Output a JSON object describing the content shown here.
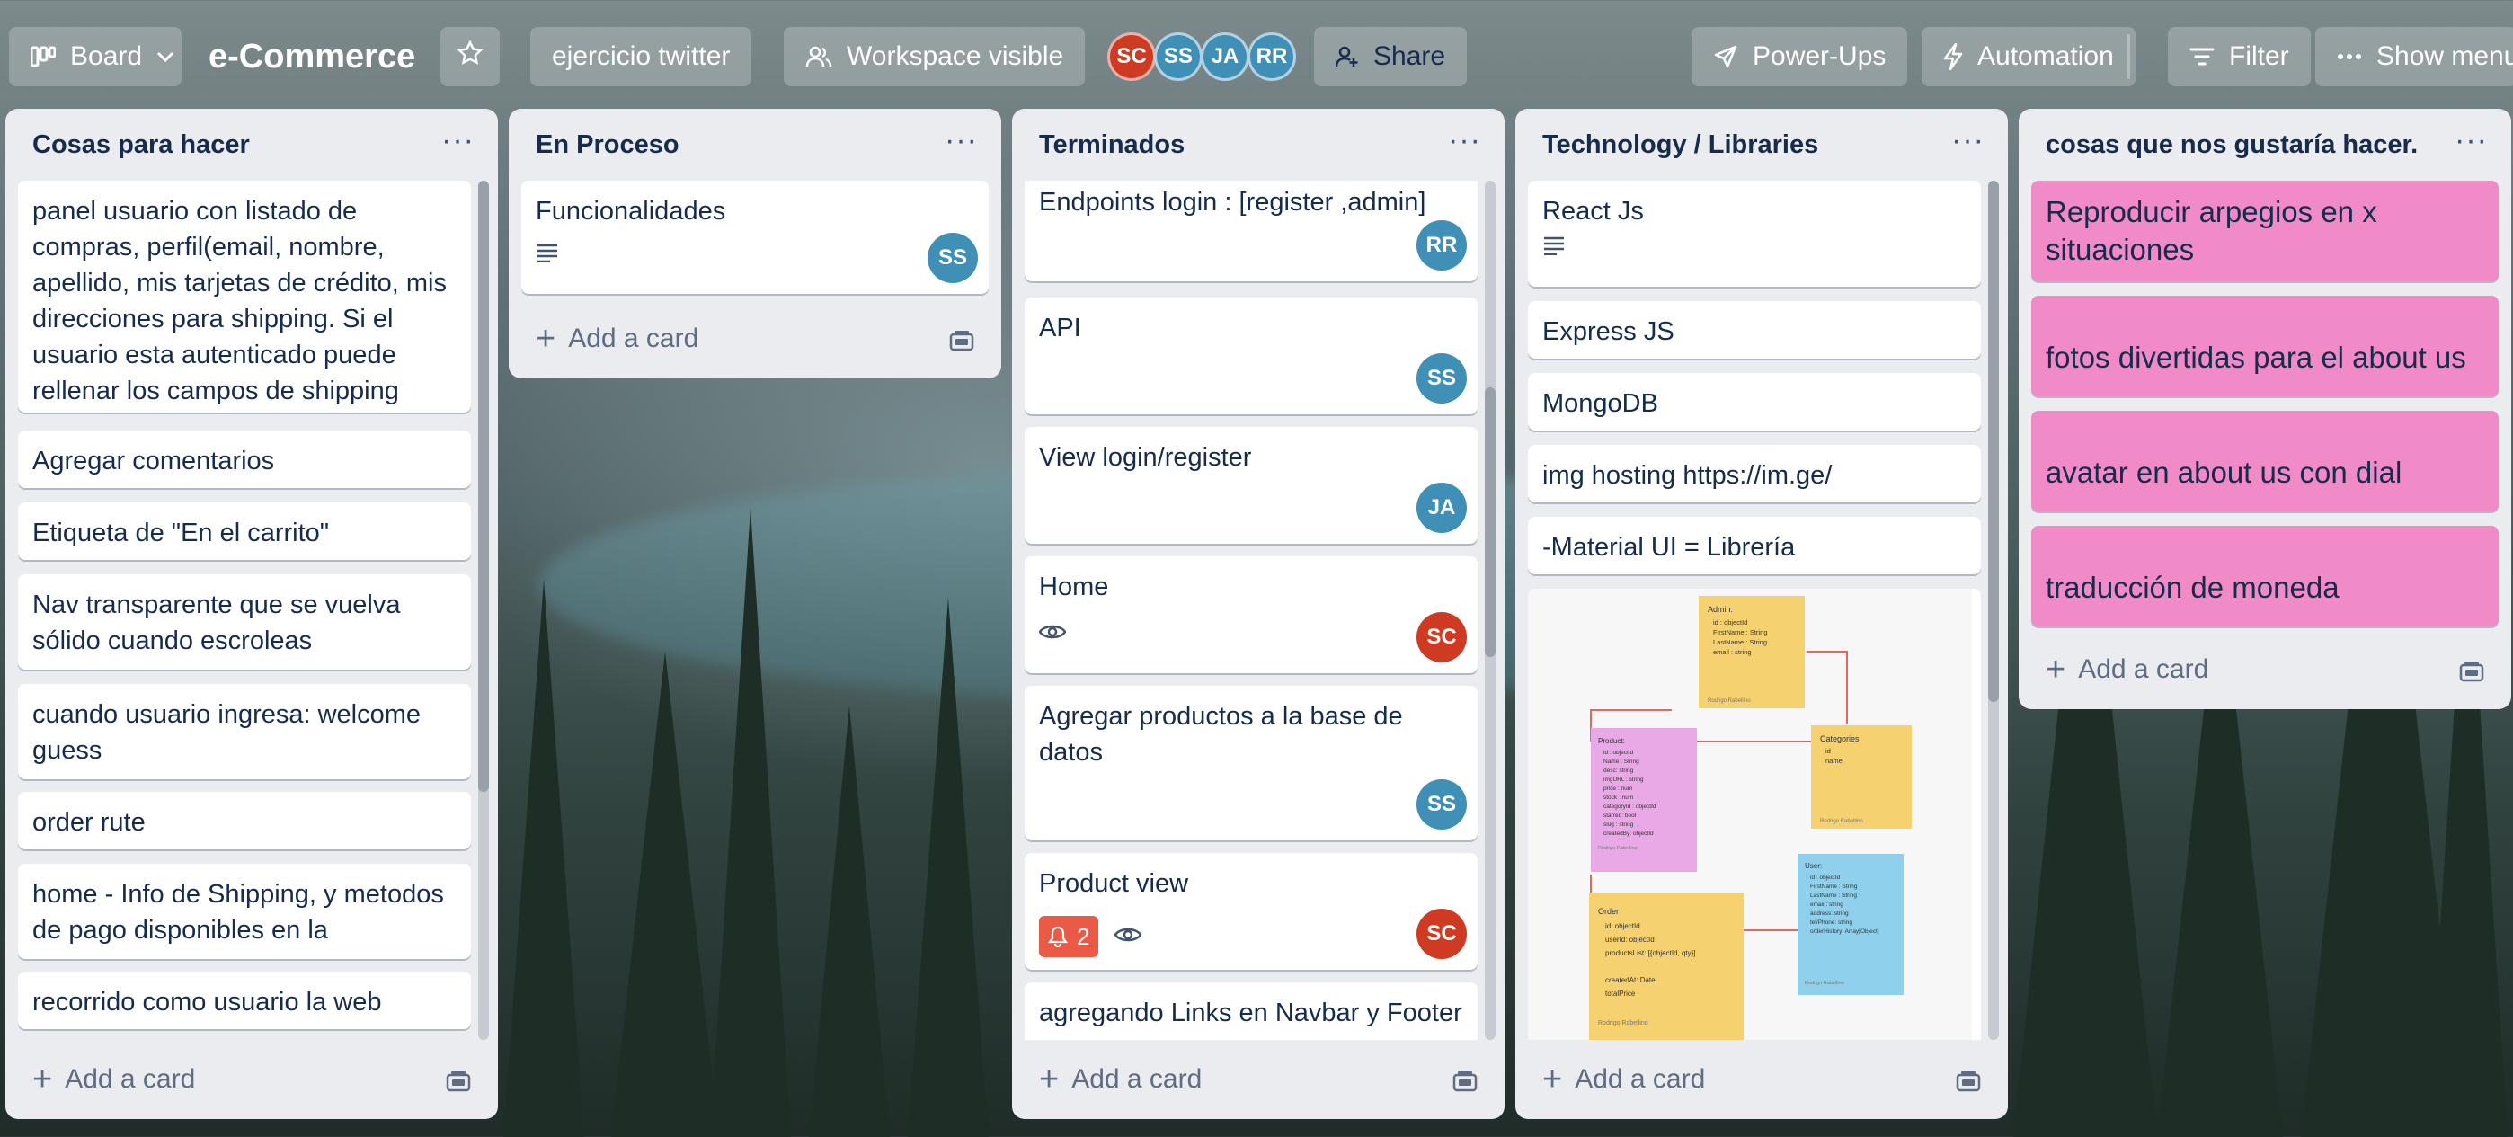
{
  "header": {
    "view_switcher": "Board",
    "board_title": "e-Commerce",
    "workspace_name": "ejercicio twitter",
    "visibility": "Workspace visible",
    "members": [
      "SC",
      "SS",
      "JA",
      "RR"
    ],
    "share": "Share",
    "power_ups": "Power-Ups",
    "automation": "Automation",
    "filter": "Filter",
    "show_menu": "Show menu"
  },
  "lists": [
    {
      "title": "Cosas para hacer",
      "cards": [
        {
          "text": "panel usuario con listado de compras, perfil(email, nombre, apellido, mis tarjetas de crédito, mis direcciones para shipping. Si el usuario esta autenticado puede rellenar los campos de shipping"
        },
        {
          "text": "Agregar comentarios"
        },
        {
          "text": "Etiqueta de \"En el carrito\""
        },
        {
          "text": "Nav transparente que se vuelva sólido cuando escroleas"
        },
        {
          "text": "cuando usuario ingresa: welcome guess"
        },
        {
          "text": "order rute"
        },
        {
          "text": "home - Info de Shipping, y metodos de pago disponibles en la"
        },
        {
          "text": "recorrido como usuario la web"
        }
      ],
      "add_card": "Add a card"
    },
    {
      "title": "En Proceso",
      "cards": [
        {
          "text": "Funcionalidades",
          "member": "SS"
        }
      ],
      "add_card": "Add a card"
    },
    {
      "title": "Terminados",
      "cards": [
        {
          "text": "Endpoints login : [register ,admin]",
          "member": "RR"
        },
        {
          "text": "API",
          "member": "SS"
        },
        {
          "text": "View login/register",
          "member": "JA"
        },
        {
          "text": "Home",
          "member": "SC"
        },
        {
          "text": "Agregar productos a la base de datos",
          "member": "SS"
        },
        {
          "text": "Product view",
          "member": "SC",
          "notifications": "2"
        },
        {
          "text": "agregando Links en Navbar y Footer"
        }
      ],
      "add_card": "Add a card"
    },
    {
      "title": "Technology / Libraries",
      "cards": [
        {
          "text": "React Js"
        },
        {
          "text": "Express JS"
        },
        {
          "text": "MongoDB"
        },
        {
          "text": "img hosting https://im.ge/"
        },
        {
          "text": "-Material UI = Librería"
        }
      ],
      "diagram": {
        "admin": {
          "title": "Admin:",
          "fields": [
            "id : objectId",
            "FirstName : String",
            "LastName : String",
            "email : string"
          ],
          "author": "Rodrigo Rabellino"
        },
        "categories": {
          "title": "Categories",
          "fields": [
            "id",
            "name"
          ],
          "author": "Rodrigo Rabellino"
        },
        "product": {
          "title": "Product:",
          "fields": [
            "id : objectId",
            "Name : String",
            "desc: string",
            "imgURL : string",
            "price : num",
            "stock : num",
            "categoryId : objectId",
            "starred: bool",
            "slug : string",
            "createdBy: objectId"
          ],
          "author": "Rodrigo Rabellino"
        },
        "user": {
          "title": "User:",
          "fields": [
            "id : objectId",
            "FirstName : String",
            "LastName : String",
            "email : string",
            "address: string",
            "tel/Phone: string",
            "orderHistory: Array[Object]"
          ],
          "author": "Rodrigo Rabellino"
        },
        "order": {
          "title": "Order",
          "fields": [
            "id: objectId",
            "userId: objectId",
            "productsList: [{objectId, qty}]",
            "createdAt: Date",
            "totalPrice"
          ],
          "author": "Rodrigo Rabellino"
        }
      },
      "add_card": "Add a card"
    },
    {
      "title": "cosas que nos gustaría hacer.",
      "cards": [
        {
          "text": "Reproducir arpegios en x situaciones"
        },
        {
          "text": "fotos divertidas para el about us"
        },
        {
          "text": "avatar en about us con dial"
        },
        {
          "text": "traducción de moneda"
        }
      ],
      "add_card": "Add a card"
    }
  ],
  "colors": {
    "list_bg": "#ebecf0",
    "card_bg": "#ffffff",
    "pink_label": "#f08bc7",
    "avatar_sc": "#cf3a23",
    "avatar_blue": "#3f8fb7",
    "notification_red": "#eb5a46"
  },
  "icons": [
    "board-icon",
    "chevron-down-icon",
    "star-icon",
    "people-icon",
    "share-icon",
    "rocket-icon",
    "bolt-icon",
    "filter-icon",
    "dots-icon",
    "description-icon",
    "eye-icon",
    "bell-icon",
    "plus-icon",
    "template-icon"
  ]
}
